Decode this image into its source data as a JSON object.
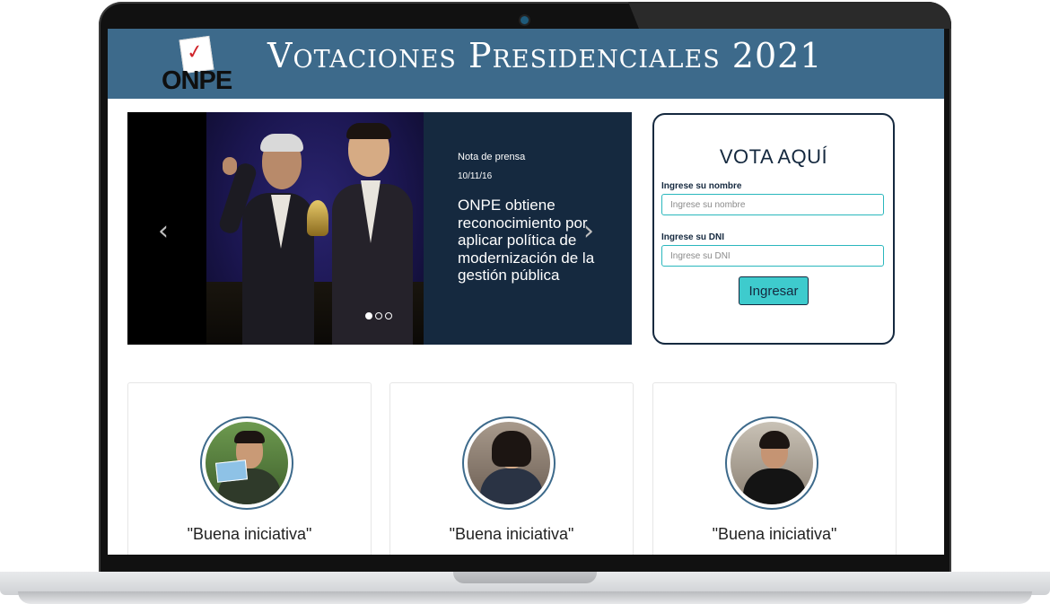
{
  "header": {
    "logo_text": "ONPE",
    "title": "Votaciones Presidenciales 2021"
  },
  "carousel": {
    "slide": {
      "kicker": "Nota de prensa",
      "date": "10/11/16",
      "headline": "ONPE obtiene reconocimiento por aplicar política de modernización de la gestión pública"
    },
    "prev_icon": "‹",
    "next_icon": "›",
    "active_index": 0,
    "slide_count": 3
  },
  "vote_form": {
    "title": "VOTA AQUÍ",
    "name_label": "Ingrese su nombre",
    "name_placeholder": "Ingrese su nombre",
    "dni_label": "Ingrese su DNI",
    "dni_placeholder": "Ingrese su DNI",
    "submit_label": "Ingresar"
  },
  "testimonials": [
    {
      "quote": "\"Buena iniciativa\""
    },
    {
      "quote": "\"Buena iniciativa\""
    },
    {
      "quote": "\"Buena iniciativa\""
    }
  ],
  "colors": {
    "header_bg": "#3d6a8b",
    "navy": "#15293f",
    "accent_teal": "#3ecbcd",
    "input_border": "#2ab7bd"
  }
}
